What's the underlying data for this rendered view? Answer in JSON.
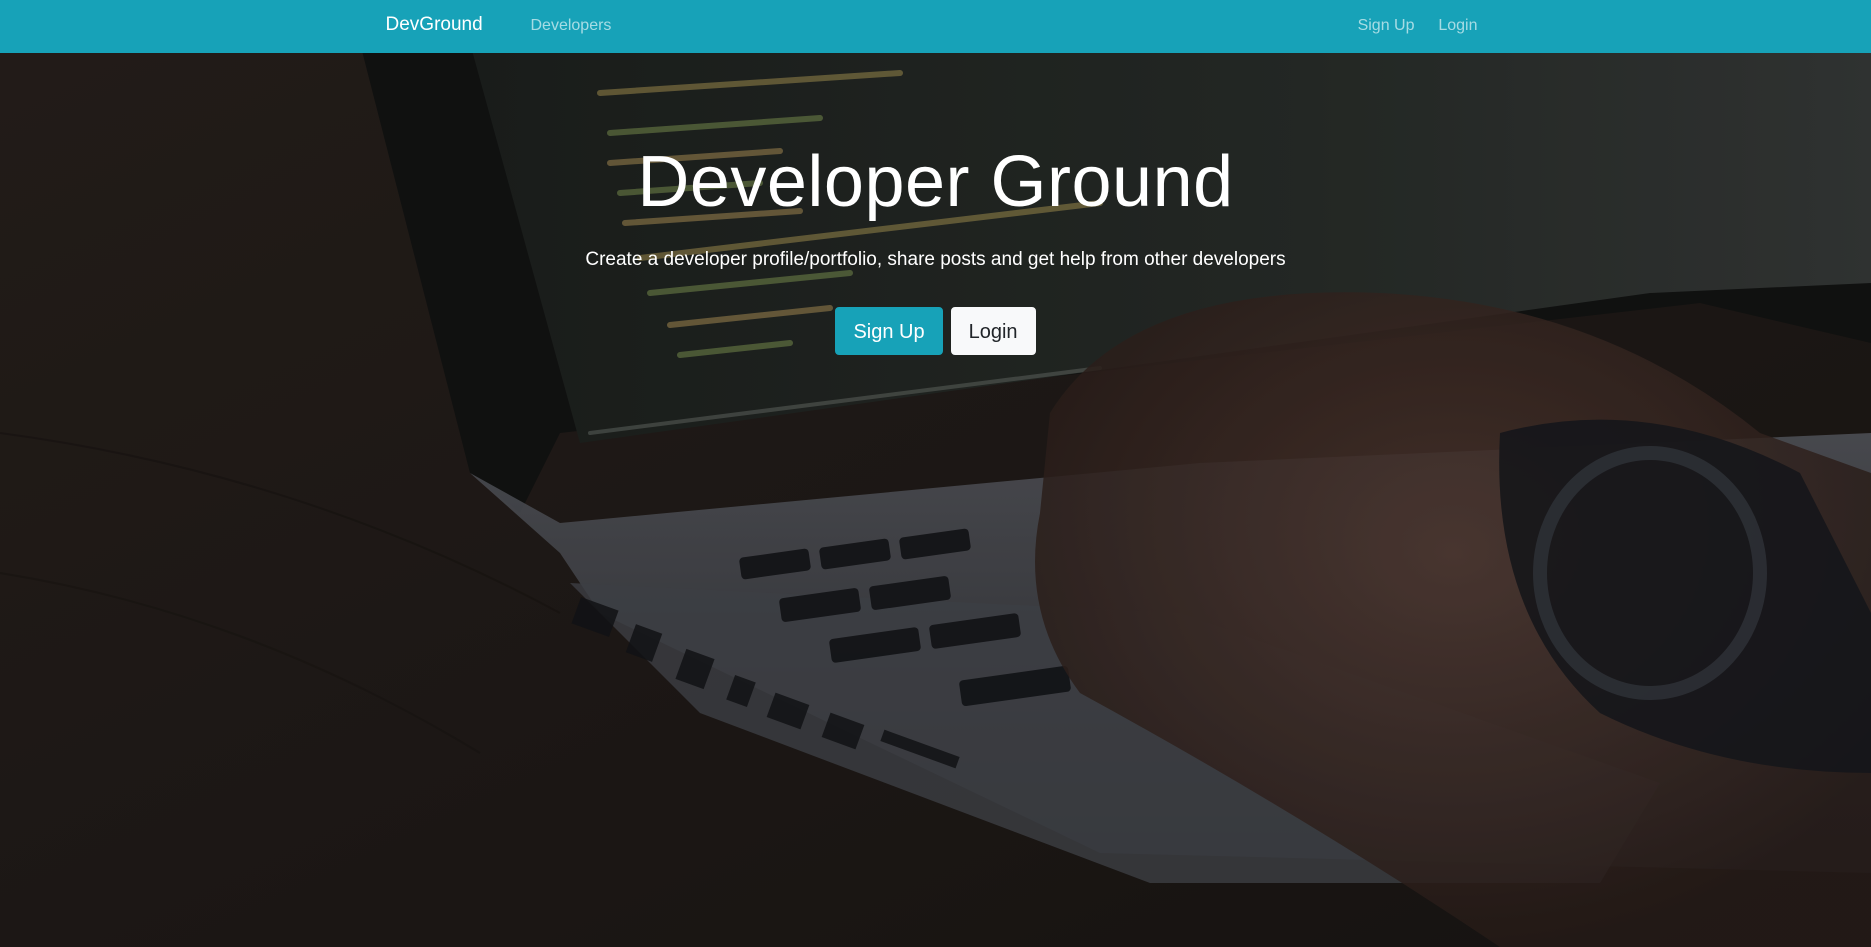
{
  "navbar": {
    "brand": "DevGround",
    "developers_link": "Developers",
    "signup_link": "Sign Up",
    "login_link": "Login",
    "background_color": "#17a2b8"
  },
  "hero": {
    "title": "Developer Ground",
    "lead": "Create a developer profile/portfolio, share posts and get help from other developers",
    "signup_button": "Sign Up",
    "login_button": "Login",
    "background_image": "laptop-code-photo"
  },
  "colors": {
    "accent": "#17a2b8",
    "light_button": "#f8f9fa",
    "text_light": "#ffffff"
  }
}
